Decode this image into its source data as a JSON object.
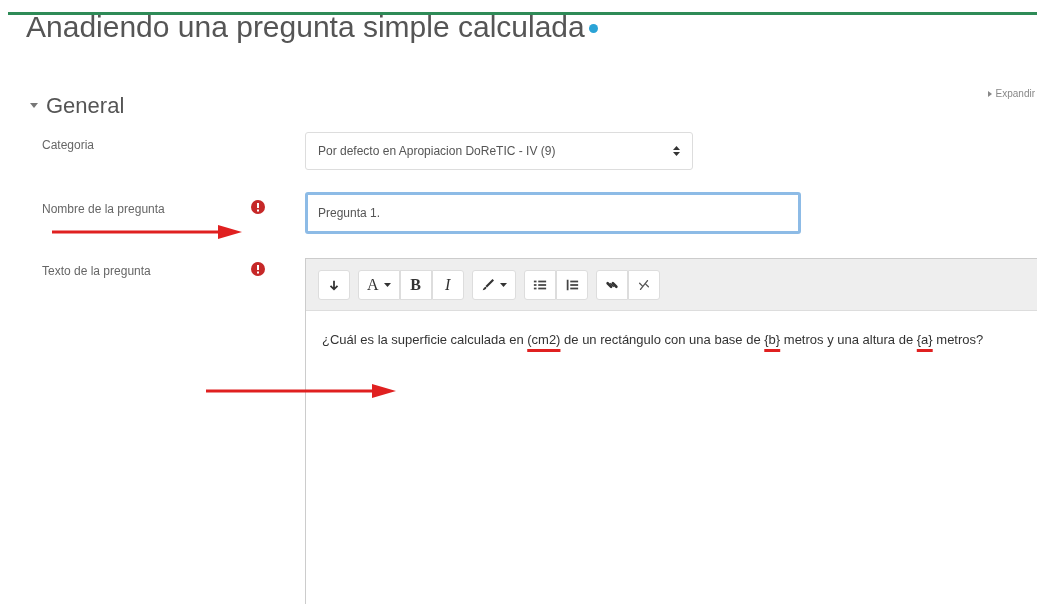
{
  "page_title": "Anadiendo una pregunta simple calculada",
  "expand_link": "Expandir",
  "section": {
    "title": "General",
    "expanded": true
  },
  "fields": [
    {
      "kind": "select",
      "label": "Categoria",
      "required": false,
      "value": "Por defecto en Apropiacion DoReTIC - IV (9)"
    },
    {
      "kind": "text",
      "label": "Nombre de la pregunta",
      "required": true,
      "value": "Pregunta 1.",
      "focused": true
    },
    {
      "kind": "editor",
      "label": "Texto de la pregunta",
      "required": true,
      "toolbar": [
        [
          {
            "kind": "expand",
            "caret": false
          }
        ],
        [
          {
            "kind": "font",
            "label": "A",
            "caret": true
          },
          {
            "kind": "bold",
            "label": "B",
            "caret": false
          },
          {
            "kind": "italic",
            "label": "I",
            "caret": false
          }
        ],
        [
          {
            "kind": "brush",
            "caret": true
          }
        ],
        [
          {
            "kind": "bullets",
            "caret": false
          },
          {
            "kind": "numbers",
            "caret": false
          }
        ],
        [
          {
            "kind": "link",
            "caret": false
          },
          {
            "kind": "unlink",
            "caret": false
          }
        ]
      ],
      "content": [
        {
          "text": "¿Cuál es la superficie calculada en ",
          "marked": false
        },
        {
          "text": "(cm2)",
          "marked": true
        },
        {
          "text": " de un rectángulo con una base de ",
          "marked": false
        },
        {
          "text": "{b}",
          "marked": true
        },
        {
          "text": " metros  y una altura de ",
          "marked": false
        },
        {
          "text": "{a}",
          "marked": true
        },
        {
          "text": " metros?",
          "marked": false
        }
      ]
    }
  ]
}
